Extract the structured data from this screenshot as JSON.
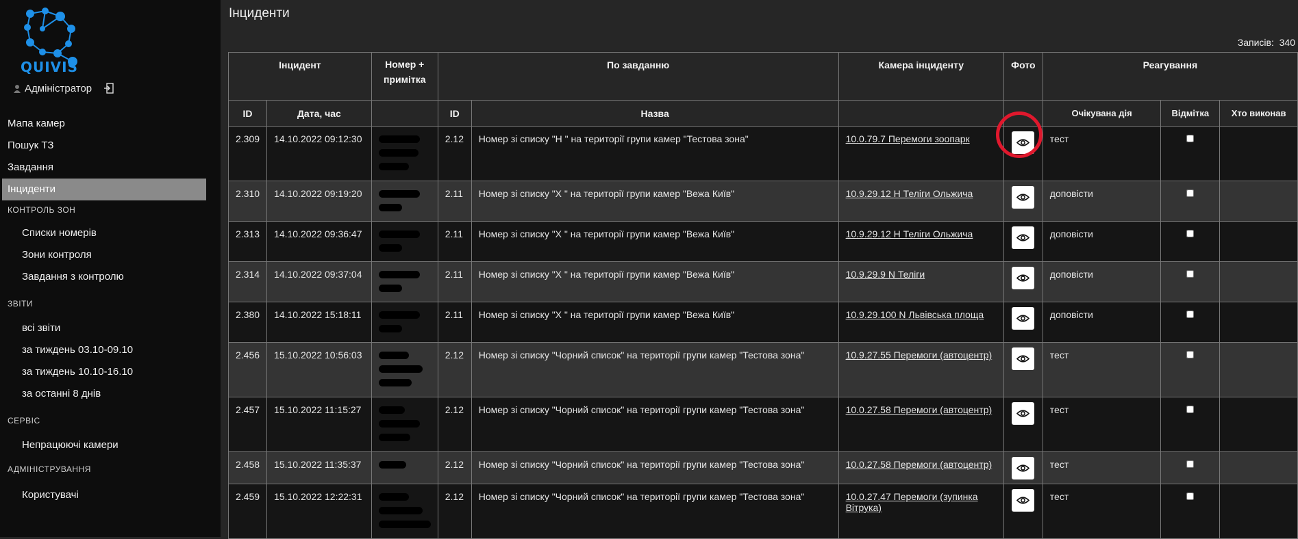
{
  "app": {
    "logo_text": "QUIVIS",
    "user_name": "Адміністратор"
  },
  "nav": {
    "items": [
      {
        "label": "Мапа камер",
        "active": false
      },
      {
        "label": "Пошук ТЗ",
        "active": false
      },
      {
        "label": "Завдання",
        "active": false
      },
      {
        "label": "Інциденти",
        "active": true
      }
    ],
    "sections": [
      {
        "title": "Контроль зон",
        "items": [
          "Списки номерів",
          "Зони контроля",
          "Завдання з контролю"
        ]
      },
      {
        "title": "Звіти",
        "items": [
          "всі звіти",
          "за тиждень 03.10-09.10",
          "за тиждень 10.10-16.10",
          "за останні 8 днів"
        ]
      },
      {
        "title": "Сервіс",
        "items": [
          "Непрацюючі камери"
        ]
      },
      {
        "title": "Адміністрування",
        "items": [
          "Користувачі"
        ]
      }
    ]
  },
  "page": {
    "title": "Інциденти",
    "records_label": "Записів:",
    "records_count": "340"
  },
  "table": {
    "group_headers": {
      "incident": "Інцидент",
      "number_note": "Номер + примітка",
      "by_task": "По завданню",
      "camera": "Камера інциденту",
      "photo": "Фото",
      "reaction": "Реагування"
    },
    "sub_headers": {
      "id": "ID",
      "datetime": "Дата, час",
      "task_id": "ID",
      "name": "Назва",
      "expected_action": "Очікувана дія",
      "mark": "Відмітка",
      "who_done": "Хто виконав"
    },
    "rows": [
      {
        "id": "2.309",
        "datetime": "14.10.2022 09:12:30",
        "task_id": "2.12",
        "name": "Номер зі списку \"Н                 \" на території групи камер \"Тестова зона\"",
        "camera": "10.0.79.7  Перемоги зоопарк",
        "action": "тест"
      },
      {
        "id": "2.310",
        "datetime": "14.10.2022 09:19:20",
        "task_id": "2.11",
        "name": "Номер зі списку \"Х                    \" на території групи камер \"Вежа Київ\"",
        "camera": "10.9.29.12  Н  Теліги  Ольжича",
        "action": "доповісти"
      },
      {
        "id": "2.313",
        "datetime": "14.10.2022 09:36:47",
        "task_id": "2.11",
        "name": "Номер зі списку \"Х                    \" на території групи камер \"Вежа Київ\"",
        "camera": "10.9.29.12  Н  Теліги  Ольжича",
        "action": "доповісти"
      },
      {
        "id": "2.314",
        "datetime": "14.10.2022 09:37:04",
        "task_id": "2.11",
        "name": "Номер зі списку \"Х                    \" на території групи камер \"Вежа Київ\"",
        "camera": "10.9.29.9  N  Теліги",
        "action": "доповісти"
      },
      {
        "id": "2.380",
        "datetime": "14.10.2022 15:18:11",
        "task_id": "2.11",
        "name": "Номер зі списку \"Х                    \" на території групи камер \"Вежа Київ\"",
        "camera": "10.9.29.100  N  Львівська площа",
        "action": "доповісти"
      },
      {
        "id": "2.456",
        "datetime": "15.10.2022 10:56:03",
        "task_id": "2.12",
        "name": "Номер зі списку \"Чорний список\" на території групи камер \"Тестова зона\"",
        "camera": "10.9.27.55  Перемоги (автоцентр)",
        "action": "тест"
      },
      {
        "id": "2.457",
        "datetime": "15.10.2022 11:15:27",
        "task_id": "2.12",
        "name": "Номер зі списку \"Чорний список\" на території групи камер \"Тестова зона\"",
        "camera": "10.0.27.58  Перемоги (автоцентр)",
        "action": "тест"
      },
      {
        "id": "2.458",
        "datetime": "15.10.2022 11:35:37",
        "task_id": "2.12",
        "name": "Номер зі списку \"Чорний список\" на території групи камер \"Тестова зона\"",
        "camera": "10.0.27.58  Перемоги (автоцентр)",
        "action": "тест"
      },
      {
        "id": "2.459",
        "datetime": "15.10.2022 12:22:31",
        "task_id": "2.12",
        "name": "Номер зі списку \"Чорний список\" на території групи камер \"Тестова зона\"",
        "camera": "10.0.27.47  Перемоги (зупинка Вітрука)",
        "action": "тест"
      }
    ]
  },
  "colors": {
    "accent": "#1e90e8",
    "active_nav": "#8a8a8a",
    "highlight_circle": "#e0182d"
  }
}
